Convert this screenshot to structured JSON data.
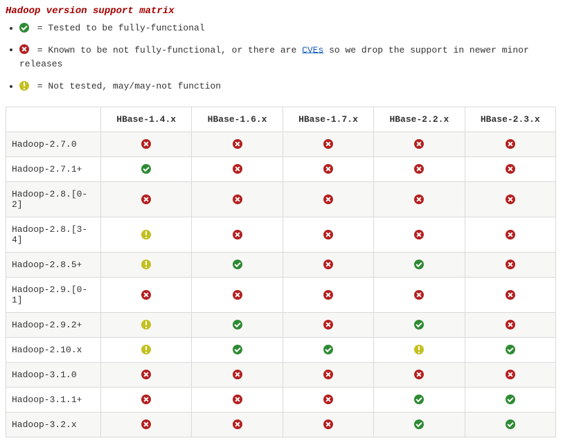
{
  "title": "Hadoop version support matrix",
  "legend": [
    {
      "status": "ok",
      "text": " = Tested to be fully-functional"
    },
    {
      "status": "bad",
      "text_before": " = Known to be not fully-functional, or there are ",
      "link_text": "CVEs",
      "text_after": " so we drop the support in newer minor releases"
    },
    {
      "status": "warn",
      "text": " = Not tested, may/may-not function"
    }
  ],
  "columns": [
    "HBase-1.4.x",
    "HBase-1.6.x",
    "HBase-1.7.x",
    "HBase-2.2.x",
    "HBase-2.3.x"
  ],
  "rows": [
    {
      "label": "Hadoop-2.7.0",
      "cells": [
        "bad",
        "bad",
        "bad",
        "bad",
        "bad"
      ]
    },
    {
      "label": "Hadoop-2.7.1+",
      "cells": [
        "ok",
        "bad",
        "bad",
        "bad",
        "bad"
      ]
    },
    {
      "label": "Hadoop-2.8.[0-2]",
      "cells": [
        "bad",
        "bad",
        "bad",
        "bad",
        "bad"
      ]
    },
    {
      "label": "Hadoop-2.8.[3-4]",
      "cells": [
        "warn",
        "bad",
        "bad",
        "bad",
        "bad"
      ]
    },
    {
      "label": "Hadoop-2.8.5+",
      "cells": [
        "warn",
        "ok",
        "bad",
        "ok",
        "bad"
      ]
    },
    {
      "label": "Hadoop-2.9.[0-1]",
      "cells": [
        "bad",
        "bad",
        "bad",
        "bad",
        "bad"
      ]
    },
    {
      "label": "Hadoop-2.9.2+",
      "cells": [
        "warn",
        "ok",
        "bad",
        "ok",
        "bad"
      ]
    },
    {
      "label": "Hadoop-2.10.x",
      "cells": [
        "warn",
        "ok",
        "ok",
        "warn",
        "ok"
      ]
    },
    {
      "label": "Hadoop-3.1.0",
      "cells": [
        "bad",
        "bad",
        "bad",
        "bad",
        "bad"
      ]
    },
    {
      "label": "Hadoop-3.1.1+",
      "cells": [
        "bad",
        "bad",
        "bad",
        "ok",
        "ok"
      ]
    },
    {
      "label": "Hadoop-3.2.x",
      "cells": [
        "bad",
        "bad",
        "bad",
        "ok",
        "ok"
      ]
    }
  ],
  "status_names": {
    "ok": "check-circle-icon",
    "bad": "x-circle-icon",
    "warn": "exclamation-circle-icon"
  }
}
